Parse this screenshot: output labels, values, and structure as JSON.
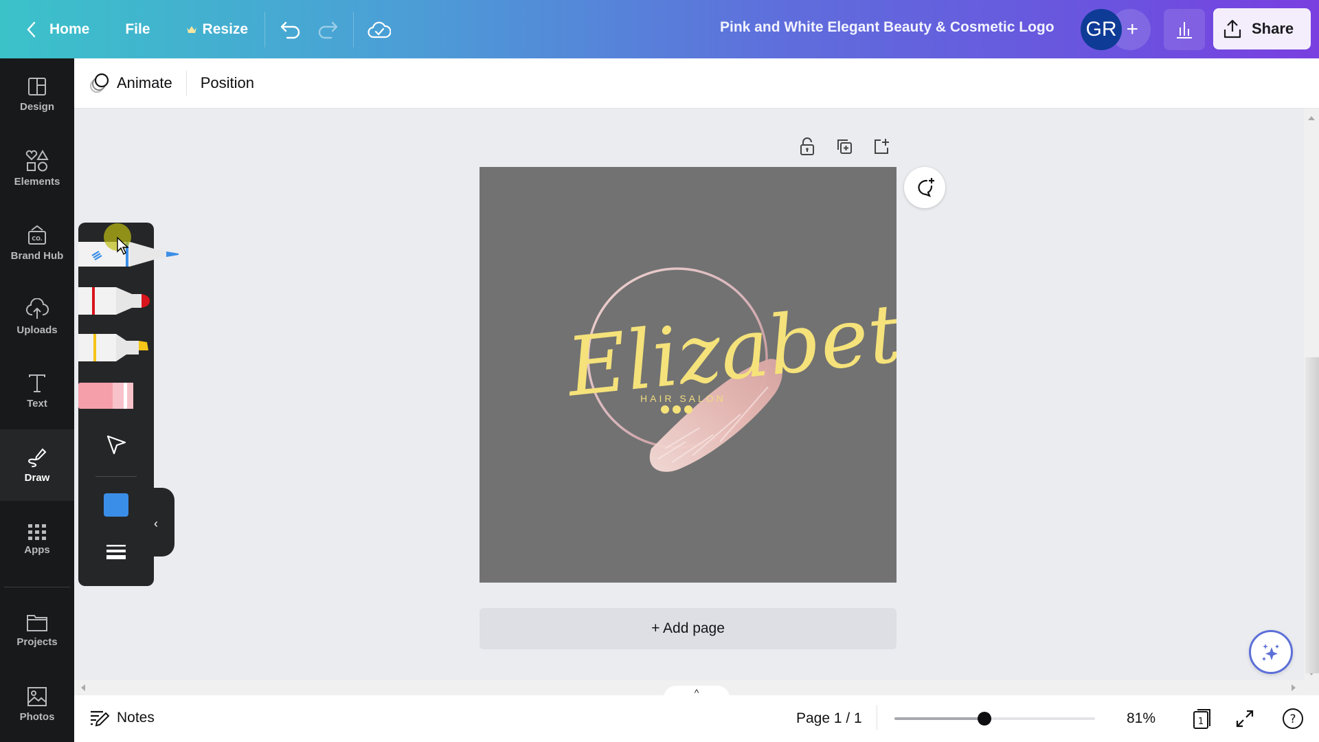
{
  "topbar": {
    "home_label": "Home",
    "file_label": "File",
    "resize_label": "Resize",
    "design_title": "Pink and White Elegant Beauty & Cosmetic Logo",
    "avatar_initials": "GR",
    "invite_symbol": "+",
    "share_label": "Share"
  },
  "rail": {
    "items": [
      {
        "label": "Design",
        "icon": "layout-icon"
      },
      {
        "label": "Elements",
        "icon": "shapes-icon"
      },
      {
        "label": "Brand Hub",
        "icon": "brand-hub-icon"
      },
      {
        "label": "Uploads",
        "icon": "cloud-upload-icon"
      },
      {
        "label": "Text",
        "icon": "text-icon"
      },
      {
        "label": "Draw",
        "icon": "draw-icon",
        "active": true
      },
      {
        "label": "Apps",
        "icon": "apps-grid-icon"
      },
      {
        "label": "Projects",
        "icon": "folder-icon"
      },
      {
        "label": "Photos",
        "icon": "image-icon"
      }
    ]
  },
  "context_toolbar": {
    "animate_label": "Animate",
    "position_label": "Position"
  },
  "draw_panel": {
    "tools": [
      "pen",
      "marker",
      "highlighter",
      "eraser",
      "select"
    ],
    "active_tool": "pen",
    "current_color": "#3b8ee8",
    "pen_colors": {
      "pen": "#3b8ee8",
      "marker": "#d8141c",
      "highlighter": "#f5c518",
      "eraser": "#f59fab"
    },
    "collapse_symbol": "‹"
  },
  "canvas": {
    "page_background": "#727272",
    "logo": {
      "name_text": "Elizabeth",
      "tagline": "HAIR SALON",
      "name_color": "#f5e27a",
      "ring_color": "#e6c2c0",
      "brush_color": "#f0c7c4"
    },
    "add_page_label": "+ Add page"
  },
  "footer": {
    "notes_label": "Notes",
    "page_indicator": "Page 1 / 1",
    "zoom_percent": 81,
    "zoom_label": "81%",
    "zoom_slider_fraction": 0.45,
    "page_count_badge": "1",
    "help_symbol": "?"
  },
  "scroll": {
    "expand_symbol": "^"
  }
}
